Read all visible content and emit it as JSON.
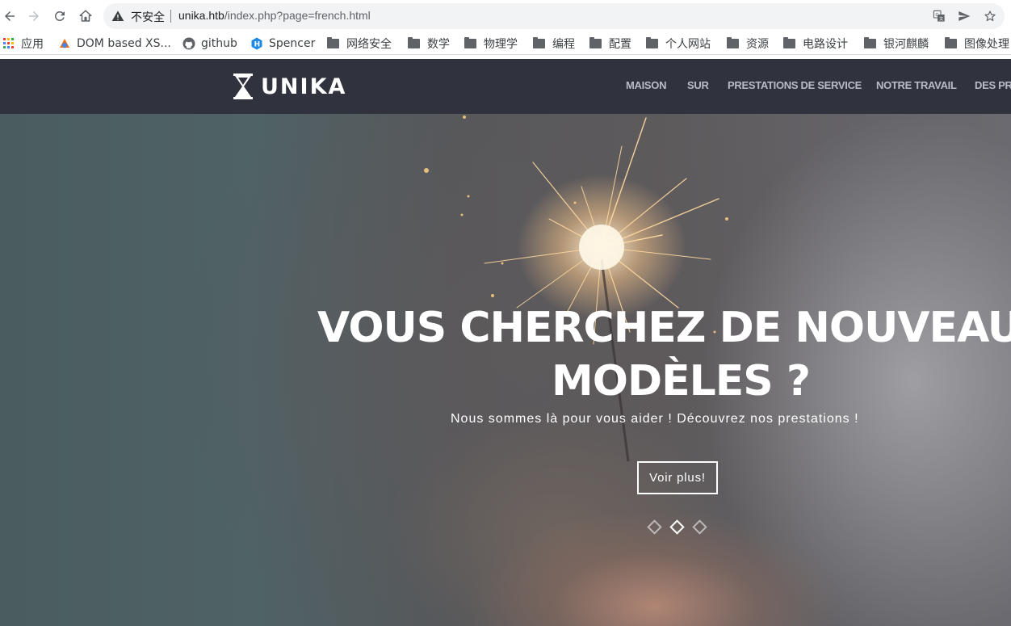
{
  "browser": {
    "insecure_label": "不安全",
    "url_host": "unika.htb",
    "url_path": "/index.php?page=french.html",
    "icons": [
      "back-icon",
      "forward-icon",
      "reload-icon",
      "home-icon",
      "warning-icon",
      "translate-icon",
      "send-icon",
      "star-icon"
    ]
  },
  "bookmarks": [
    {
      "label": "应用",
      "icon": "apps-icon"
    },
    {
      "label": "DOM based XS...",
      "icon": "site-icon"
    },
    {
      "label": "github",
      "icon": "github-icon"
    },
    {
      "label": "Spencer",
      "icon": "hexo-icon"
    },
    {
      "label": "网络安全",
      "icon": "folder-icon"
    },
    {
      "label": "数学",
      "icon": "folder-icon"
    },
    {
      "label": "物理学",
      "icon": "folder-icon"
    },
    {
      "label": "编程",
      "icon": "folder-icon"
    },
    {
      "label": "配置",
      "icon": "folder-icon"
    },
    {
      "label": "个人网站",
      "icon": "folder-icon"
    },
    {
      "label": "资源",
      "icon": "folder-icon"
    },
    {
      "label": "电路设计",
      "icon": "folder-icon"
    },
    {
      "label": "银河麒麟",
      "icon": "folder-icon"
    },
    {
      "label": "图像处理",
      "icon": "folder-icon"
    }
  ],
  "site": {
    "logo_text": "UNIKA",
    "menu": [
      "MAISON",
      "SUR",
      "PRESTATIONS DE SERVICE",
      "NOTRE TRAVAIL",
      "DES PRIX"
    ]
  },
  "hero": {
    "title_line1": "VOUS CHERCHEZ DE NOUVEAUX",
    "title_line2": "MODÈLES ?",
    "subtitle": "Nous sommes là pour vous aider ! Découvrez nos prestations !",
    "button_label": "Voir plus!",
    "slides": 3,
    "active_slide": 2
  },
  "colors": {
    "header_bg": "#30333d",
    "menu_text": "#b9bcc4",
    "hero_text": "#ffffff"
  }
}
